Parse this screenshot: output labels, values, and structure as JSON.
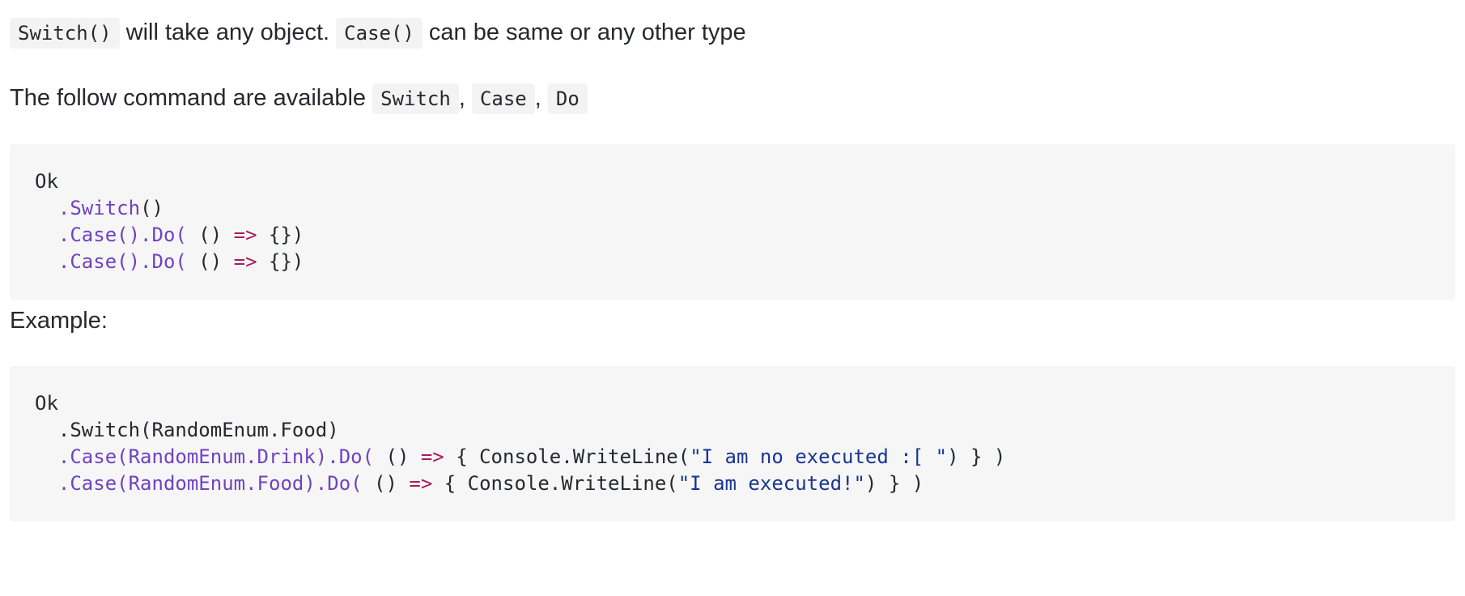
{
  "intro": {
    "code1": "Switch()",
    "text1": " will take any object. ",
    "code2": "Case()",
    "text2": " can be same or any other type"
  },
  "commands": {
    "text": "The follow command are available ",
    "items": [
      "Switch",
      "Case",
      "Do"
    ],
    "sep": ", "
  },
  "block1": {
    "l1": "Ok",
    "l2_indent": "  ",
    "l2_method": ".Switch",
    "l2_rest": "()",
    "l3_indent": "  ",
    "l3_method": ".Case().Do(",
    "l3_a": " () ",
    "l3_op": "=>",
    "l3_b": " {})",
    "l4_indent": "  ",
    "l4_method": ".Case().Do(",
    "l4_a": " () ",
    "l4_op": "=>",
    "l4_b": " {})"
  },
  "example_label": "Example:",
  "block2": {
    "l1": "Ok",
    "l2": "  .Switch(RandomEnum.Food)",
    "l3_indent": "  ",
    "l3_method": ".Case(RandomEnum.Drink).Do(",
    "l3_a": " () ",
    "l3_op": "=>",
    "l3_b": " { Console.WriteLine(",
    "l3_str": "\"I am no executed :[ \"",
    "l3_c": ") } )",
    "l4_indent": "  ",
    "l4_method": ".Case(RandomEnum.Food).Do(",
    "l4_a": " () ",
    "l4_op": "=>",
    "l4_b": " { Console.WriteLine(",
    "l4_str": "\"I am executed!\"",
    "l4_c": ") } )"
  }
}
